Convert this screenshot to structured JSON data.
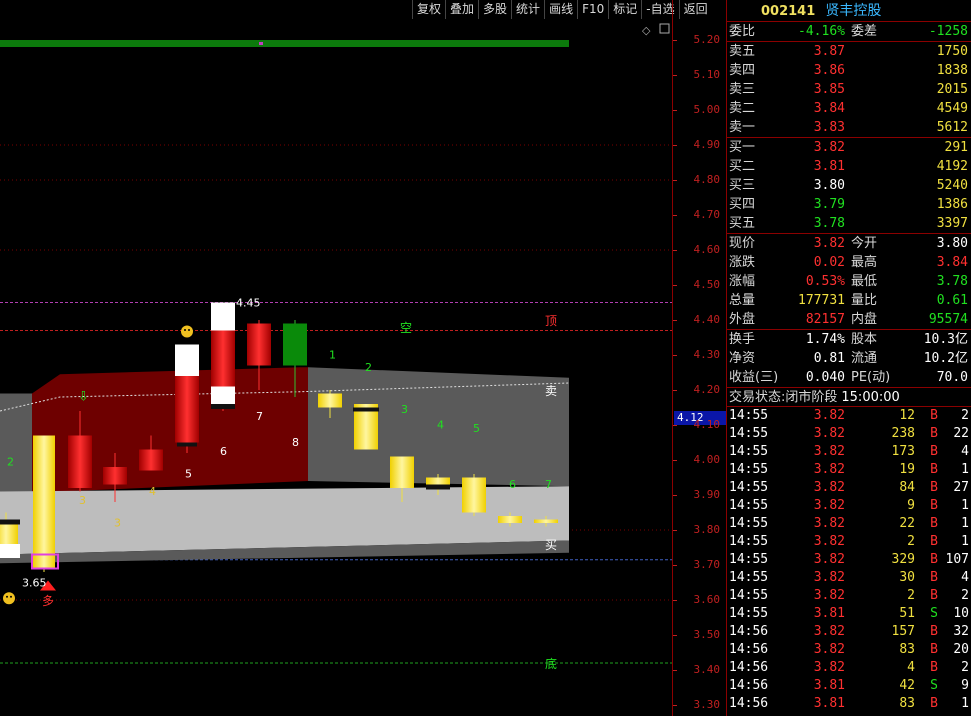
{
  "toolbar": [
    "复权",
    "叠加",
    "多股",
    "统计",
    "画线",
    "F10",
    "标记",
    "-自选",
    "返回"
  ],
  "stock": {
    "code": "002141",
    "name": "贤丰控股"
  },
  "weibi": {
    "label1": "委比",
    "value1": "-4.16%",
    "label2": "委差",
    "value2": "-1258"
  },
  "sell": [
    {
      "label": "卖五",
      "price": "3.87",
      "volume": "1750"
    },
    {
      "label": "卖四",
      "price": "3.86",
      "volume": "1838"
    },
    {
      "label": "卖三",
      "price": "3.85",
      "volume": "2015"
    },
    {
      "label": "卖二",
      "price": "3.84",
      "volume": "4549"
    },
    {
      "label": "卖一",
      "price": "3.83",
      "volume": "5612"
    }
  ],
  "buy": [
    {
      "label": "买一",
      "price": "3.82",
      "volume": "291",
      "color": "red"
    },
    {
      "label": "买二",
      "price": "3.81",
      "volume": "4192",
      "color": "red"
    },
    {
      "label": "买三",
      "price": "3.80",
      "volume": "5240",
      "color": "white"
    },
    {
      "label": "买四",
      "price": "3.79",
      "volume": "1386",
      "color": "green"
    },
    {
      "label": "买五",
      "price": "3.78",
      "volume": "3397",
      "color": "green"
    }
  ],
  "stats": [
    {
      "l1": "现价",
      "v1": "3.82",
      "c1": "red",
      "l2": "今开",
      "v2": "3.80",
      "c2": "white"
    },
    {
      "l1": "涨跌",
      "v1": "0.02",
      "c1": "red",
      "l2": "最高",
      "v2": "3.84",
      "c2": "red"
    },
    {
      "l1": "涨幅",
      "v1": "0.53%",
      "c1": "red",
      "l2": "最低",
      "v2": "3.78",
      "c2": "green"
    },
    {
      "l1": "总量",
      "v1": "177731",
      "c1": "yellow",
      "l2": "量比",
      "v2": "0.61",
      "c2": "green"
    },
    {
      "l1": "外盘",
      "v1": "82157",
      "c1": "red",
      "l2": "内盘",
      "v2": "95574",
      "c2": "green"
    }
  ],
  "stats2": [
    {
      "l1": "换手",
      "v1": "1.74%",
      "l2": "股本",
      "v2": "10.3亿"
    },
    {
      "l1": "净资",
      "v1": "0.81",
      "l2": "流通",
      "v2": "10.2亿"
    },
    {
      "l1": "收益(三)",
      "v1": "0.040",
      "l2": "PE(动)",
      "v2": "70.0"
    }
  ],
  "trade_status": {
    "label": "交易状态:闭市阶段",
    "time": "15:00:00"
  },
  "ticks": [
    {
      "time": "14:55",
      "price": "3.82",
      "vol": "12",
      "bs": "B",
      "n": "2"
    },
    {
      "time": "14:55",
      "price": "3.82",
      "vol": "238",
      "bs": "B",
      "n": "22"
    },
    {
      "time": "14:55",
      "price": "3.82",
      "vol": "173",
      "bs": "B",
      "n": "4"
    },
    {
      "time": "14:55",
      "price": "3.82",
      "vol": "19",
      "bs": "B",
      "n": "1"
    },
    {
      "time": "14:55",
      "price": "3.82",
      "vol": "84",
      "bs": "B",
      "n": "27"
    },
    {
      "time": "14:55",
      "price": "3.82",
      "vol": "9",
      "bs": "B",
      "n": "1"
    },
    {
      "time": "14:55",
      "price": "3.82",
      "vol": "22",
      "bs": "B",
      "n": "1"
    },
    {
      "time": "14:55",
      "price": "3.82",
      "vol": "2",
      "bs": "B",
      "n": "1"
    },
    {
      "time": "14:55",
      "price": "3.82",
      "vol": "329",
      "bs": "B",
      "n": "107"
    },
    {
      "time": "14:55",
      "price": "3.82",
      "vol": "30",
      "bs": "B",
      "n": "4"
    },
    {
      "time": "14:55",
      "price": "3.82",
      "vol": "2",
      "bs": "B",
      "n": "2"
    },
    {
      "time": "14:55",
      "price": "3.81",
      "vol": "51",
      "bs": "S",
      "n": "10"
    },
    {
      "time": "14:56",
      "price": "3.82",
      "vol": "157",
      "bs": "B",
      "n": "32"
    },
    {
      "time": "14:56",
      "price": "3.82",
      "vol": "83",
      "bs": "B",
      "n": "20"
    },
    {
      "time": "14:56",
      "price": "3.82",
      "vol": "4",
      "bs": "B",
      "n": "2"
    },
    {
      "time": "14:56",
      "price": "3.81",
      "vol": "42",
      "bs": "S",
      "n": "9"
    },
    {
      "time": "14:56",
      "price": "3.81",
      "vol": "83",
      "bs": "B",
      "n": "1"
    }
  ],
  "axis": {
    "current": "4.12",
    "ticks": [
      "5.20",
      "5.10",
      "5.00",
      "4.90",
      "4.80",
      "4.70",
      "4.60",
      "4.50",
      "4.40",
      "4.30",
      "4.20",
      "4.10",
      "4.00",
      "3.90",
      "3.80",
      "3.70",
      "3.60",
      "3.50",
      "3.40",
      "3.30"
    ]
  },
  "chart_labels": {
    "high": "4.45",
    "low": "3.65",
    "top": "顶",
    "sell": "卖",
    "buy": "买",
    "bottom": "底",
    "empty": "空",
    "long": "多",
    "nums_red": [
      "2",
      "3",
      "4",
      "5",
      "6",
      "7",
      "8"
    ],
    "nums_green": [
      "1",
      "2",
      "3",
      "4",
      "5",
      "6",
      "7"
    ]
  },
  "chart_data": {
    "type": "candlestick",
    "candles": [
      {
        "open": 3.75,
        "close": 3.82,
        "high": 3.85,
        "low": 3.72,
        "color": "yellow"
      },
      {
        "open": 3.69,
        "close": 4.07,
        "high": 4.07,
        "low": 3.68,
        "color": "yellow"
      },
      {
        "open": 4.07,
        "close": 3.92,
        "high": 4.14,
        "low": 3.91,
        "color": "red"
      },
      {
        "open": 3.98,
        "close": 3.93,
        "high": 4.02,
        "low": 3.88,
        "color": "red"
      },
      {
        "open": 4.03,
        "close": 3.97,
        "high": 4.07,
        "low": 3.97,
        "color": "red"
      },
      {
        "open": 4.33,
        "close": 4.05,
        "high": 4.33,
        "low": 4.02,
        "color": "red"
      },
      {
        "open": 4.45,
        "close": 4.17,
        "high": 4.45,
        "low": 4.14,
        "color": "red"
      },
      {
        "open": 4.39,
        "close": 4.27,
        "high": 4.4,
        "low": 4.2,
        "color": "red"
      },
      {
        "open": 4.27,
        "close": 4.39,
        "high": 4.4,
        "low": 4.18,
        "color": "green"
      },
      {
        "open": 4.19,
        "close": 4.15,
        "high": 4.2,
        "low": 4.12,
        "color": "yellow"
      },
      {
        "open": 4.16,
        "close": 4.03,
        "high": 4.16,
        "low": 4.03,
        "color": "yellow"
      },
      {
        "open": 4.01,
        "close": 3.92,
        "high": 4.01,
        "low": 3.88,
        "color": "yellow"
      },
      {
        "open": 3.95,
        "close": 3.93,
        "high": 3.96,
        "low": 3.9,
        "color": "yellow"
      },
      {
        "open": 3.95,
        "close": 3.85,
        "high": 3.96,
        "low": 3.84,
        "color": "yellow"
      },
      {
        "open": 3.84,
        "close": 3.82,
        "high": 3.85,
        "low": 3.81,
        "color": "yellow"
      },
      {
        "open": 3.83,
        "close": 3.82,
        "high": 3.84,
        "low": 3.81,
        "color": "yellow"
      }
    ],
    "ylim": [
      3.3,
      5.2
    ]
  }
}
